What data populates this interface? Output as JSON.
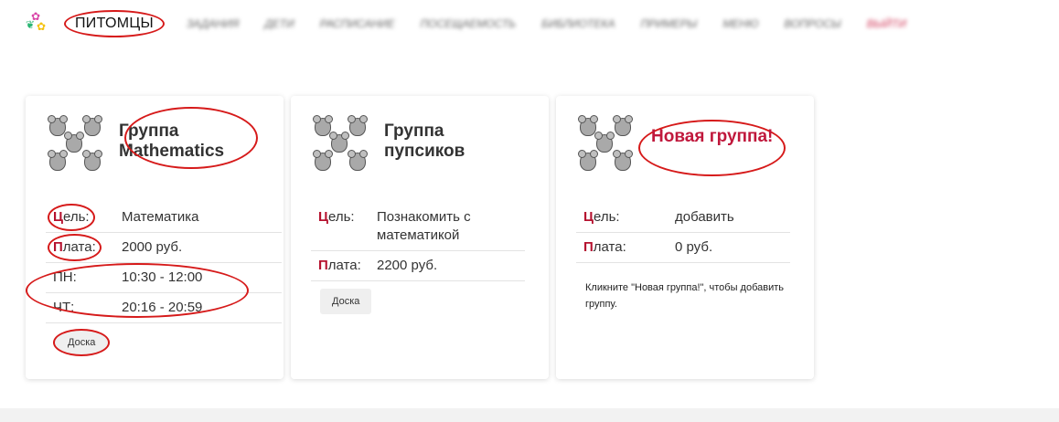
{
  "header": {
    "logo": "pets-logo",
    "main_nav": "ПИТОМЦЫ",
    "blurred_nav": [
      "ЗАДАНИЯ",
      "ДЕТИ",
      "РАСПИСАНИЕ",
      "ПОСЕЩАЕМОСТЬ",
      "БИБЛИОТЕКА",
      "ПРИМЕРЫ",
      "МЕНЮ",
      "ВОПРОСЫ",
      "ВЫЙТИ"
    ],
    "accent_color": "#c0183c",
    "annotation_color": "#d61a1a"
  },
  "cards": [
    {
      "title": "Группа Mathematics",
      "goal_label": "Цель:",
      "goal_value": "Математика",
      "fee_label": "Плата:",
      "fee_value": "2000 руб.",
      "schedule": [
        {
          "day": "ПН:",
          "time": "10:30 - 12:00"
        },
        {
          "day": "ЧТ:",
          "time": "20:16 - 20:59"
        }
      ],
      "button": "Доска"
    },
    {
      "title": "Группа пупсиков",
      "goal_label": "Цель:",
      "goal_value": "Познакомить с математикой",
      "fee_label": "Плата:",
      "fee_value": "2200 руб.",
      "button": "Доска"
    },
    {
      "title": "Новая группа!",
      "goal_label": "Цель:",
      "goal_value": "добавить",
      "fee_label": "Плата:",
      "fee_value": "0 руб.",
      "hint": "Кликните \"Новая группа!\", чтобы добавить группу."
    }
  ]
}
